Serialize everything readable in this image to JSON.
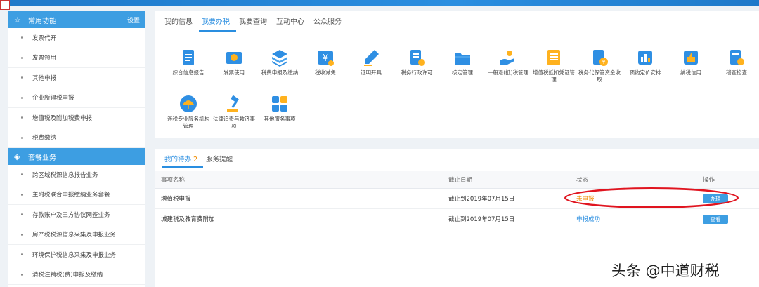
{
  "sidebar": {
    "section1": {
      "title": "常用功能",
      "right": "设置"
    },
    "items1": [
      {
        "label": "发票代开"
      },
      {
        "label": "发票领用"
      },
      {
        "label": "其他申报"
      },
      {
        "label": "企业所得税申报"
      },
      {
        "label": "增值税及附加税费申报"
      },
      {
        "label": "税费缴纳"
      }
    ],
    "section2": {
      "title": "套餐业务"
    },
    "items2": [
      {
        "label": "跨区域税源信息报告业务"
      },
      {
        "label": "主附税联合申报缴纳业务套餐"
      },
      {
        "label": "存款账户及三方协议网签业务"
      },
      {
        "label": "房产税税源信息采集及申报业务"
      },
      {
        "label": "环境保护税信息采集及申报业务"
      },
      {
        "label": "清税注销税(费)申报及缴纳"
      }
    ]
  },
  "main_tabs": [
    {
      "label": "我的信息"
    },
    {
      "label": "我要办税"
    },
    {
      "label": "我要查询"
    },
    {
      "label": "互动中心"
    },
    {
      "label": "公众服务"
    }
  ],
  "functions": [
    {
      "label": "综合信息报告",
      "icon": "report-icon"
    },
    {
      "label": "发票使用",
      "icon": "invoice-icon"
    },
    {
      "label": "税费申报及缴纳",
      "icon": "layers-icon"
    },
    {
      "label": "税收减免",
      "icon": "yen-icon"
    },
    {
      "label": "证明开具",
      "icon": "pen-icon"
    },
    {
      "label": "税务行政许可",
      "icon": "permit-icon"
    },
    {
      "label": "核定管理",
      "icon": "folder-icon"
    },
    {
      "label": "一般退(抵)税管理",
      "icon": "hand-coin-icon"
    },
    {
      "label": "增值税抵扣凭证管理",
      "icon": "voucher-icon"
    },
    {
      "label": "税务代保管资金收取",
      "icon": "fund-icon"
    },
    {
      "label": "预约定价安排",
      "icon": "chart-icon"
    },
    {
      "label": "纳税信用",
      "icon": "thumbs-up-icon"
    },
    {
      "label": "稽查检查",
      "icon": "inspect-icon"
    },
    {
      "label": "涉税专业服务机构管理",
      "icon": "umbrella-icon"
    },
    {
      "label": "法律追责与救济事项",
      "icon": "gavel-icon"
    },
    {
      "label": "其他服务事项",
      "icon": "apps-icon"
    }
  ],
  "todo": {
    "tabs": [
      {
        "label": "我的待办",
        "count": "2"
      },
      {
        "label": "服务提醒"
      }
    ],
    "headers": {
      "name": "事项名称",
      "deadline": "截止日期",
      "status": "状态",
      "action": "操作"
    },
    "rows": [
      {
        "name": "增值税申报",
        "deadline": "截止到2019年07月15日",
        "status": "未申报",
        "action": "办理"
      },
      {
        "name": "城建税及教育费附加",
        "deadline": "截止到2019年07月15日",
        "status": "申报成功",
        "action": "查看"
      }
    ]
  },
  "colors": {
    "accent": "#2a8ee0",
    "sidebar_head": "#3d9ee2",
    "warning": "#f08c00",
    "highlight_oval": "#e0141f"
  },
  "watermark": "头条 @中道财税"
}
